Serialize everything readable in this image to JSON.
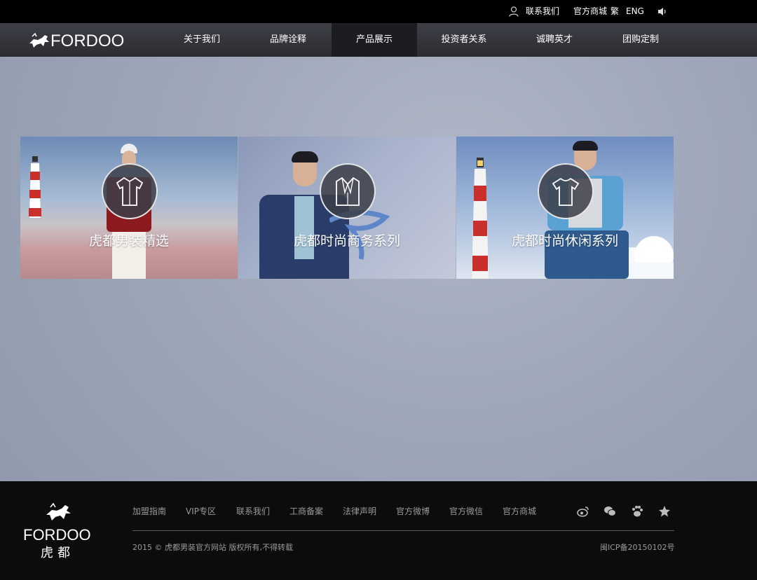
{
  "topbar": {
    "contact": "联系我们",
    "store": "官方商城",
    "traditional": "繁",
    "english": "ENG"
  },
  "brand": {
    "logo_text": "FORDOO",
    "logo_cn": "虎都"
  },
  "nav": {
    "items": [
      {
        "label": "关于我们"
      },
      {
        "label": "品牌诠释"
      },
      {
        "label": "产品展示",
        "active": true
      },
      {
        "label": "投资者关系"
      },
      {
        "label": "诚聘英才"
      },
      {
        "label": "团购定制"
      }
    ]
  },
  "cards": [
    {
      "title": "虎都男装精选",
      "icon": "shirt-icon"
    },
    {
      "title": "虎都时尚商务系列",
      "icon": "suit-jacket-icon"
    },
    {
      "title": "虎都时尚休闲系列",
      "icon": "tshirt-icon"
    }
  ],
  "footer": {
    "links": [
      "加盟指南",
      "VIP专区",
      "联系我们",
      "工商备案",
      "法律声明",
      "官方微博",
      "官方微信",
      "官方商城"
    ],
    "copyright": "2015 © 虎都男装官方网站 版权所有,不得转载",
    "icp": "闽ICP备20150102号",
    "social_icons": [
      "weibo-icon",
      "wechat-icon",
      "baidu-paw-icon",
      "star-icon"
    ]
  },
  "colors": {
    "nav_active": "#1c1d21",
    "footer_bg": "#0c0c0d",
    "page_bg": "#9da6b8"
  }
}
